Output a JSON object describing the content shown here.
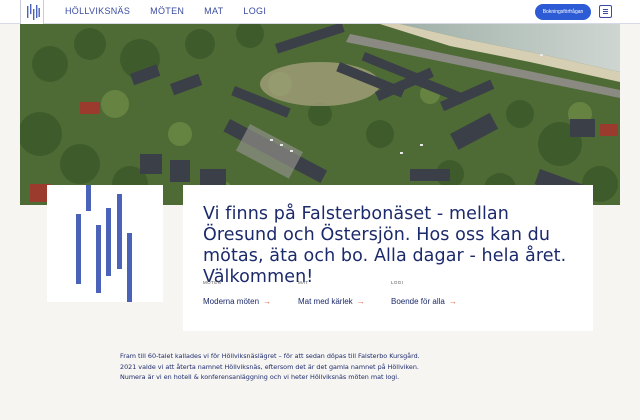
{
  "nav": {
    "items": [
      {
        "label": "HÖLLVIKSNÄS"
      },
      {
        "label": "MÖTEN"
      },
      {
        "label": "MAT"
      },
      {
        "label": "LOGI"
      }
    ],
    "booking_label": "Bokningsförfrågan"
  },
  "headline": "Vi finns på Falsterbonäset - mellan Öresund och Östersjön. Hos oss kan du mötas, äta och bo. Alla dagar - hela året. Välkommen!",
  "categories": [
    {
      "label": "MÖTEN",
      "link": "Moderna möten"
    },
    {
      "label": "MAT",
      "link": "Mat med kärlek"
    },
    {
      "label": "LOGI",
      "link": "Boende för alla"
    }
  ],
  "intro": "Fram till 60-talet kallades vi för Höllviksnäslägret – för att sedan döpas till Falsterbo Kursgård. 2021 valde vi att återta namnet Höllviksnäs, eftersom det är det gamla namnet på Höllviken. Numera är vi en hotell & konferensanläggning och vi heter Höllviksnäs möten mat logi.",
  "colors": {
    "brand_blue": "#1c2a6b",
    "button_blue": "#2d5bd6",
    "accent_orange": "#e05a3a",
    "logo_blue": "#4a63b8"
  }
}
